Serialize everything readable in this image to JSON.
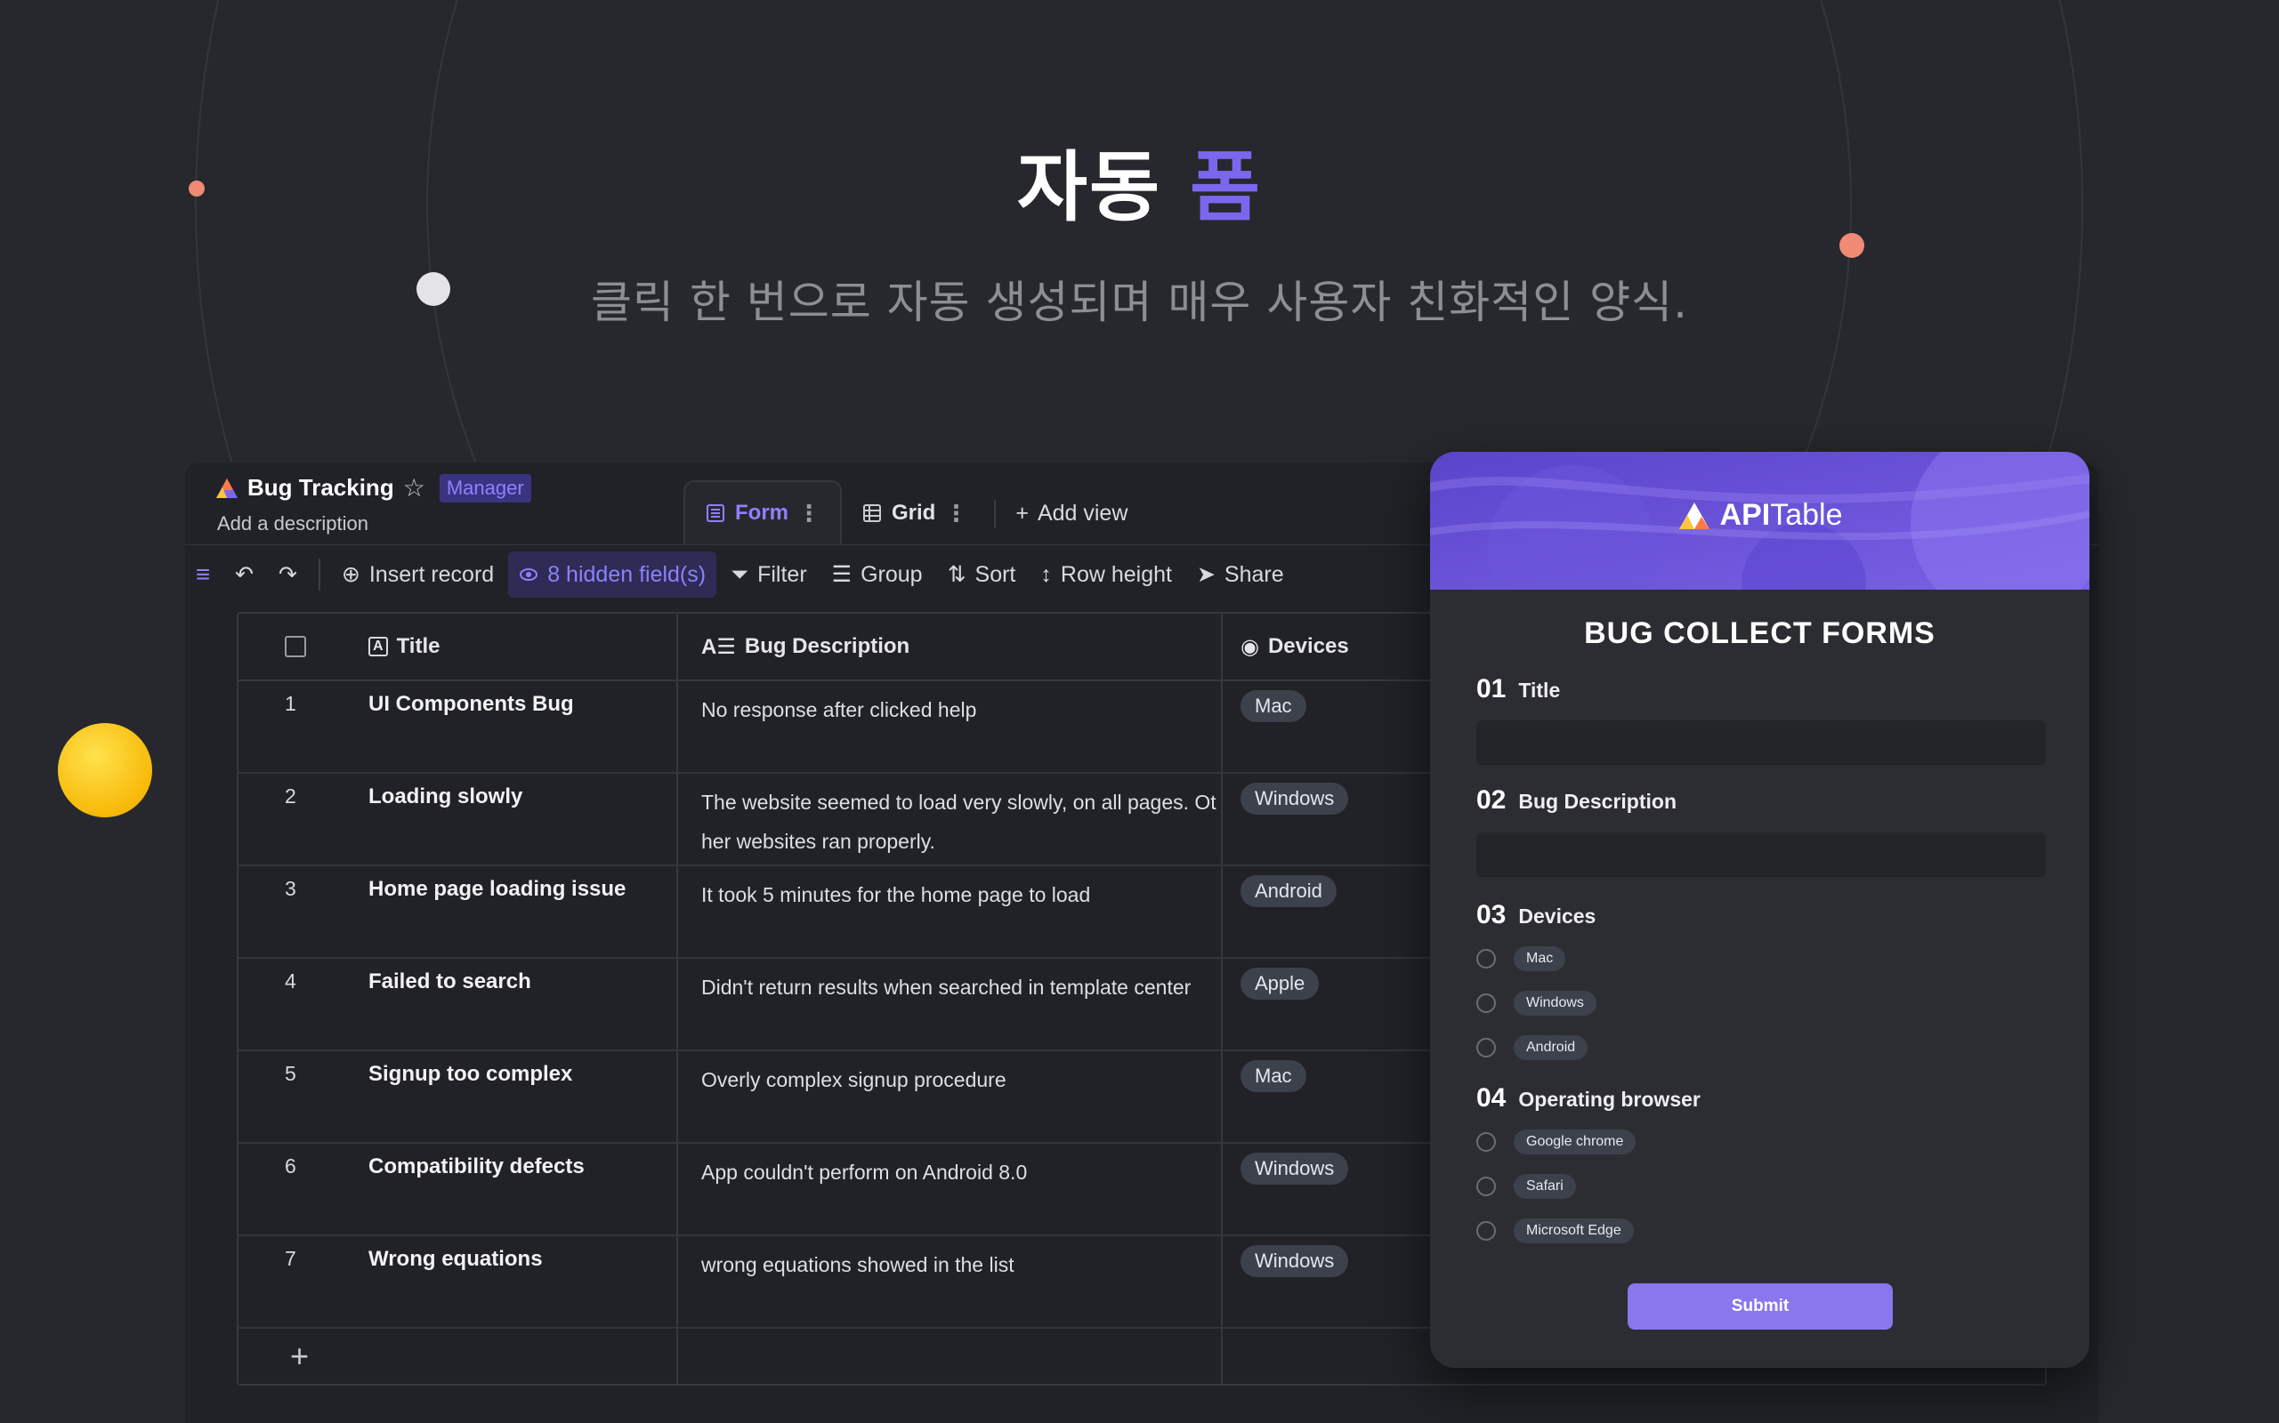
{
  "hero": {
    "title_main": "자동",
    "title_accent": "폼",
    "subtitle": "클릭 한 번으로 자동 생성되며 매우 사용자 친화적인 양식."
  },
  "colors": {
    "accent": "#7b67ee",
    "background": "#26282d",
    "submit": "#8a77ee"
  },
  "app": {
    "name": "Bug Tracking",
    "role": "Manager",
    "description": "Add a description",
    "tabs": [
      {
        "label": "Form",
        "icon": "form-icon",
        "active": true
      },
      {
        "label": "Grid",
        "icon": "grid-icon",
        "active": false
      }
    ],
    "add_view": "Add view"
  },
  "toolbar": {
    "insert_record": "Insert record",
    "hidden_fields": "8 hidden field(s)",
    "filter": "Filter",
    "group": "Group",
    "sort": "Sort",
    "row_height": "Row height",
    "share": "Share"
  },
  "grid": {
    "columns": [
      "Title",
      "Bug Description",
      "Devices"
    ],
    "rows": [
      {
        "num": "1",
        "title": "UI Components Bug",
        "desc": "No response after clicked help",
        "device": "Mac"
      },
      {
        "num": "2",
        "title": "Loading slowly",
        "desc": "The website seemed to load very slowly, on all pages.  Other websites ran properly.",
        "device": "Windows"
      },
      {
        "num": "3",
        "title": "Home page loading issue",
        "desc": "It took 5 minutes for the home page to load",
        "device": "Android"
      },
      {
        "num": "4",
        "title": "Failed to search",
        "desc": "Didn't return results when searched in template center",
        "device": "Apple"
      },
      {
        "num": "5",
        "title": "Signup too complex",
        "desc": "Overly complex signup procedure",
        "device": "Mac"
      },
      {
        "num": "6",
        "title": "Compatibility defects",
        "desc": "App couldn't perform on Android 8.0",
        "device": "Windows"
      },
      {
        "num": "7",
        "title": "Wrong equations",
        "desc": "wrong equations showed in the list",
        "device": "Windows"
      }
    ],
    "add_row": "+"
  },
  "form": {
    "brand_bold": "API",
    "brand_rest": "Table",
    "title": "BUG COLLECT FORMS",
    "q1": {
      "num": "01",
      "label": "Title"
    },
    "q2": {
      "num": "02",
      "label": "Bug Description"
    },
    "q3": {
      "num": "03",
      "label": "Devices",
      "options": [
        "Mac",
        "Windows",
        "Android"
      ]
    },
    "q4": {
      "num": "04",
      "label": "Operating browser",
      "options": [
        "Google chrome",
        "Safari",
        "Microsoft Edge"
      ]
    },
    "submit": "Submit"
  }
}
